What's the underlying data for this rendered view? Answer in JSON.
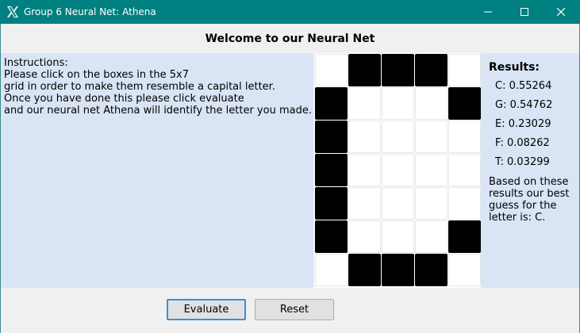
{
  "window": {
    "title": "Group 6 Neural Net: Athena",
    "titlebar_color": "#008080",
    "icon": "x-logo-icon"
  },
  "header": {
    "title": "Welcome to our Neural Net"
  },
  "instructions": {
    "lines": [
      "Instructions:",
      "Please click on the boxes in the 5x7",
      "grid in order to make them resemble a capital letter.",
      "Once you have done this please click evaluate",
      "and our neural net Athena will identify the letter you made."
    ],
    "background": "#d9e5f5"
  },
  "grid": {
    "cols": 5,
    "rows": 7,
    "cells": [
      [
        0,
        1,
        1,
        1,
        0
      ],
      [
        1,
        0,
        0,
        0,
        1
      ],
      [
        1,
        0,
        0,
        0,
        0
      ],
      [
        1,
        0,
        0,
        0,
        0
      ],
      [
        1,
        0,
        0,
        0,
        0
      ],
      [
        1,
        0,
        0,
        0,
        1
      ],
      [
        0,
        1,
        1,
        1,
        0
      ]
    ]
  },
  "results": {
    "title": "Results:",
    "scores": [
      {
        "text": "C: 0.55264"
      },
      {
        "text": "G: 0.54762"
      },
      {
        "text": "E: 0.23029"
      },
      {
        "text": "F: 0.08262"
      },
      {
        "text": "T: 0.03299"
      }
    ],
    "guess_text": "Based on these results our best guess for the letter is: C."
  },
  "buttons": {
    "evaluate": "Evaluate",
    "reset": "Reset"
  }
}
